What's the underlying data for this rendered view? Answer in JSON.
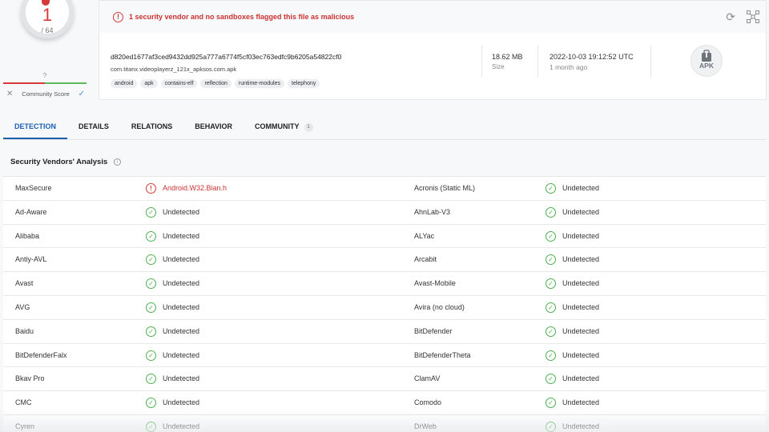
{
  "score": {
    "detections": "1",
    "total": "/ 64",
    "community_value": "?",
    "community_label": "Community Score",
    "close_glyph": "✕",
    "check_glyph": "✓",
    "colors": {
      "malicious": "#d43a3a",
      "clean": "#5cb85c"
    }
  },
  "summary": {
    "alert_text": "1 security vendor and no sandboxes flagged this file as malicious",
    "alert_glyph": "!",
    "reload_glyph": "⟳",
    "hash": "d820ed1677af3ced9432dd925a777a6774f5cf03ec763edfc9b6205a54822cf0",
    "filename": "com.titanx.videoplayerz_121x_apksos.com.apk",
    "tags": [
      "android",
      "apk",
      "contains-elf",
      "reflection",
      "runtime-modules",
      "telephony"
    ],
    "size_value": "18.62 MB",
    "size_label": "Size",
    "date_value": "2022-10-03 19:12:52 UTC",
    "date_label": "1 month ago",
    "filetype_label": "APK"
  },
  "tabs": [
    {
      "label": "DETECTION",
      "active": true
    },
    {
      "label": "DETAILS"
    },
    {
      "label": "RELATIONS"
    },
    {
      "label": "BEHAVIOR"
    },
    {
      "label": "COMMUNITY",
      "count": "1"
    }
  ],
  "section": {
    "title": "Security Vendors' Analysis",
    "info_glyph": "i"
  },
  "status_glyphs": {
    "ok": "✓",
    "bad": "!"
  },
  "vendors": [
    {
      "left": "MaxSecure",
      "left_result": "Android.W32.Bian.h",
      "left_flagged": true,
      "right": "Acronis (Static ML)",
      "right_result": "Undetected"
    },
    {
      "left": "Ad-Aware",
      "left_result": "Undetected",
      "right": "AhnLab-V3",
      "right_result": "Undetected"
    },
    {
      "left": "Alibaba",
      "left_result": "Undetected",
      "right": "ALYac",
      "right_result": "Undetected"
    },
    {
      "left": "Antiy-AVL",
      "left_result": "Undetected",
      "right": "Arcabit",
      "right_result": "Undetected"
    },
    {
      "left": "Avast",
      "left_result": "Undetected",
      "right": "Avast-Mobile",
      "right_result": "Undetected"
    },
    {
      "left": "AVG",
      "left_result": "Undetected",
      "right": "Avira (no cloud)",
      "right_result": "Undetected"
    },
    {
      "left": "Baidu",
      "left_result": "Undetected",
      "right": "BitDefender",
      "right_result": "Undetected"
    },
    {
      "left": "BitDefenderFalx",
      "left_result": "Undetected",
      "right": "BitDefenderTheta",
      "right_result": "Undetected"
    },
    {
      "left": "Bkav Pro",
      "left_result": "Undetected",
      "right": "ClamAV",
      "right_result": "Undetected"
    },
    {
      "left": "CMC",
      "left_result": "Undetected",
      "right": "Comodo",
      "right_result": "Undetected"
    },
    {
      "left": "Cyren",
      "left_result": "Undetected",
      "right": "DrWeb",
      "right_result": "Undetected"
    }
  ]
}
